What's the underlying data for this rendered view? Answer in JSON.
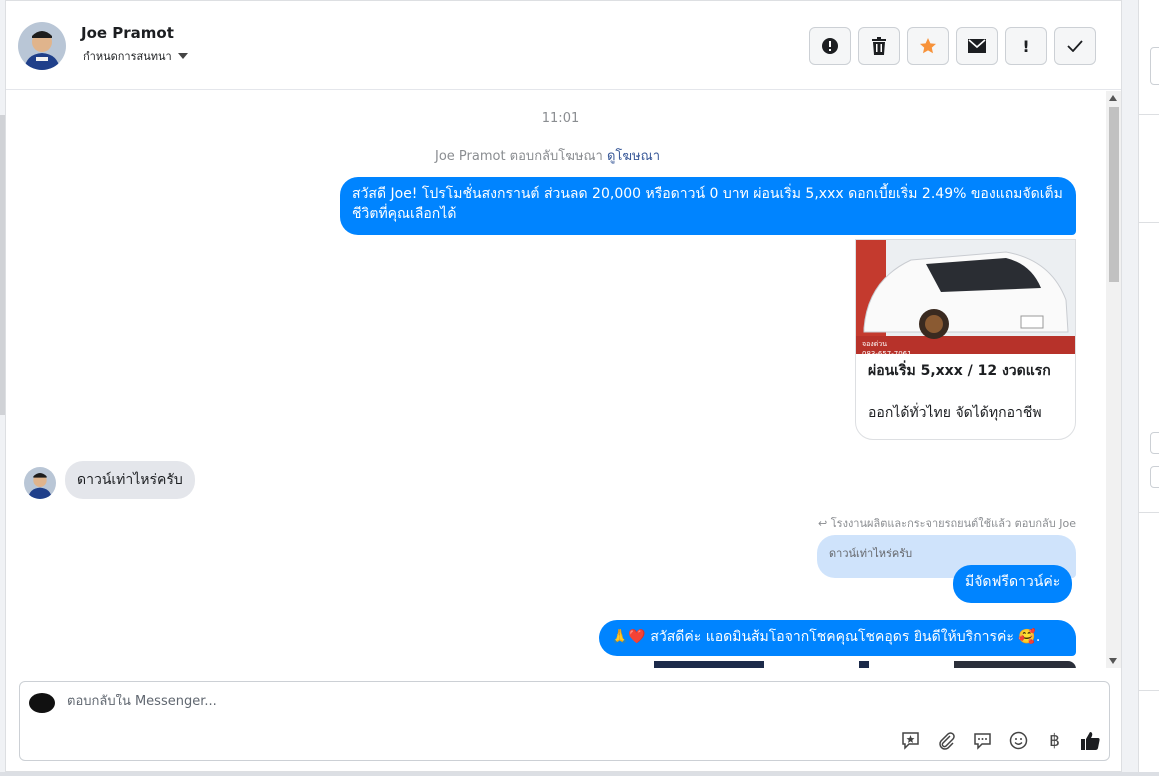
{
  "header": {
    "name": "Joe Pramot",
    "subtitle": "กำหนดการสนทนา",
    "actions": [
      {
        "icon": "alert-circle-icon"
      },
      {
        "icon": "trash-icon"
      },
      {
        "icon": "star-icon",
        "color": "#f7923a"
      },
      {
        "icon": "mail-icon"
      },
      {
        "icon": "exclamation-icon"
      },
      {
        "icon": "check-icon"
      }
    ]
  },
  "messages": {
    "timestamp": "11:01",
    "reply_note_prefix": "Joe Pramot ตอบกลับโฆษณา",
    "reply_note_link": "ดูโฆษณา",
    "ad_text": "สวัสดี Joe! โปรโมชั่นสงกรานต์ ส่วนลด 20,000 หรือดาวน์ 0 บาท ผ่อนเริ่ม 5,xxx ดอกเบี้ยเริ่ม 2.49% ของแถมจัดเต็ม ชีวิตที่คุณเลือกได้",
    "card": {
      "title": "ผ่อนเริ่ม 5,xxx / 12 งวดแรก",
      "description": "ออกได้ทั่วไทย จัดได้ทุกอาชีพ",
      "image_badge": "จองด่วน",
      "image_phone": "083-657-7061"
    },
    "incoming_text": "ดาวน์เท่าไหร่ครับ",
    "replied_label": "โรงงานผลิตและกระจายรถยนต์ใช้แล้ว ตอบกลับ Joe",
    "quoted_text": "ดาวน์เท่าไหร่ครับ",
    "reply_text": "มีจัดฟรีดาวน์ค่ะ",
    "greeting_text": "🙏❤️ สวัสดีค่ะ แอดมินส้มโอจากโชคคุณโชคอุดร ยินดีให้บริการค่ะ 🥰."
  },
  "composer": {
    "placeholder": "ตอบกลับใน Messenger...",
    "currency_symbol": "฿",
    "tools": [
      "saved-reply-icon",
      "attachment-icon",
      "chat-bubble-icon",
      "emoji-icon",
      "baht-icon",
      "thumbs-up-icon"
    ]
  },
  "colors": {
    "outgoing": "#0084ff",
    "incoming": "#e4e6eb",
    "quoted": "#cfe3fb",
    "link": "#385898"
  }
}
